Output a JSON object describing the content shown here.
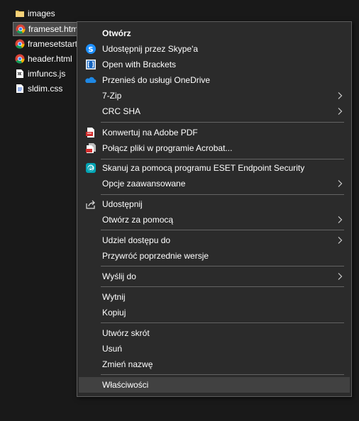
{
  "files": [
    {
      "name": "images",
      "icon": "folder-icon"
    },
    {
      "name": "frameset.html",
      "icon": "chrome-html-icon"
    },
    {
      "name": "framesetstart.html",
      "icon": "chrome-html-icon"
    },
    {
      "name": "header.html",
      "icon": "chrome-html-icon"
    },
    {
      "name": "imfuncs.js",
      "icon": "js-file-icon"
    },
    {
      "name": "sldim.css",
      "icon": "css-file-icon"
    }
  ],
  "menu": {
    "open": "Otwórz",
    "skype_share": "Udostępnij przez Skype'a",
    "brackets": "Open with Brackets",
    "onedrive": "Przenieś do usługi OneDrive",
    "zip": "7-Zip",
    "crcsha": "CRC SHA",
    "pdf_convert": "Konwertuj na Adobe PDF",
    "acrobat_merge": "Połącz pliki w programie Acrobat...",
    "eset_scan": "Skanuj za pomocą programu ESET Endpoint Security",
    "advanced": "Opcje zaawansowane",
    "share": "Udostępnij",
    "open_with": "Otwórz za pomocą",
    "give_access": "Udziel dostępu do",
    "restore": "Przywróć poprzednie wersje",
    "send_to": "Wyślij do",
    "cut": "Wytnij",
    "copy": "Kopiuj",
    "shortcut": "Utwórz skrót",
    "delete": "Usuń",
    "rename": "Zmień nazwę",
    "properties": "Właściwości"
  },
  "colors": {
    "background": "#191919",
    "menu_bg": "#2b2b2b",
    "highlight": "#414141",
    "separator": "#636363"
  }
}
